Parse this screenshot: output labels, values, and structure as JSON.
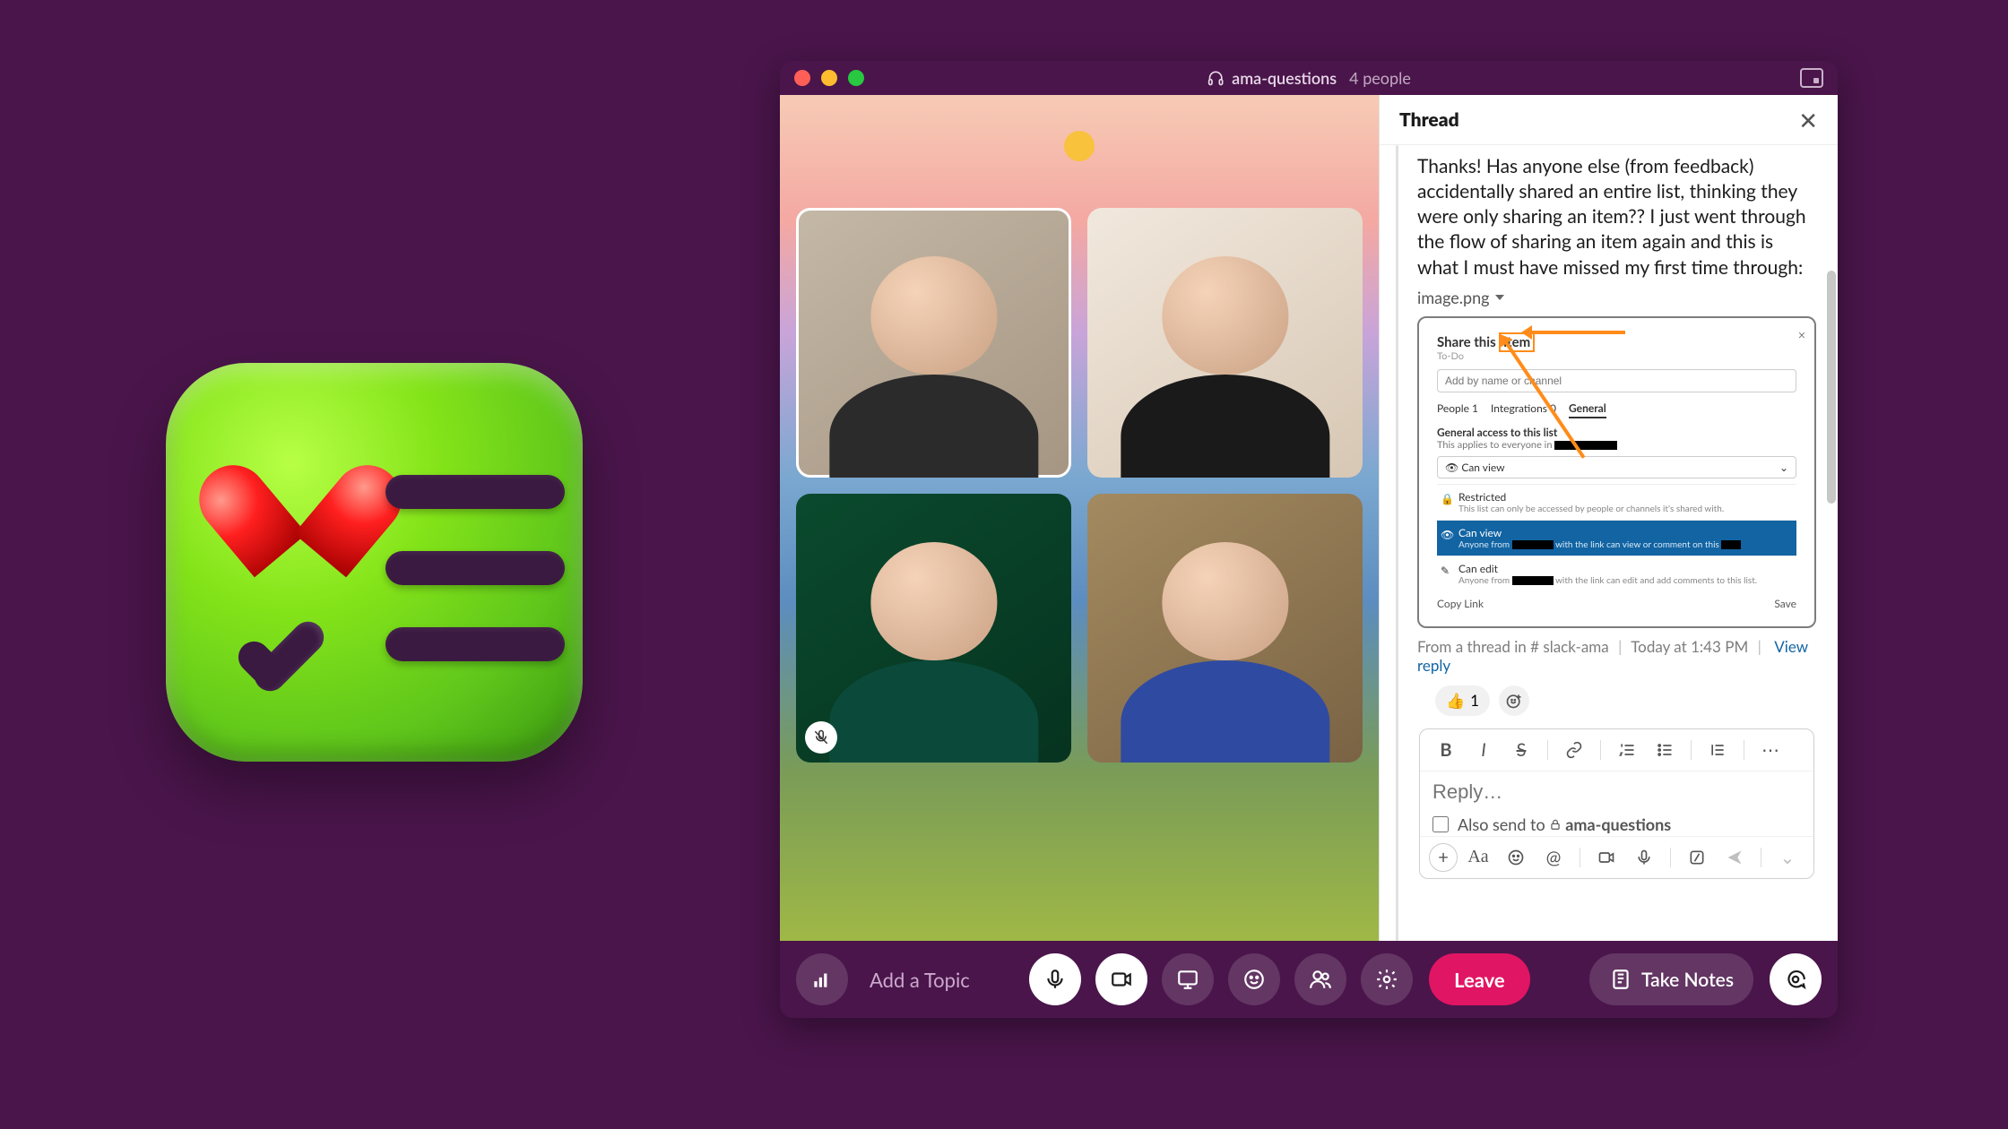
{
  "titlebar": {
    "channel_name": "ama-questions",
    "people_count": "4 people"
  },
  "thread": {
    "header": "Thread",
    "message": "Thanks! Has anyone else (from feedback) accidentally shared an entire list, thinking they were only sharing an item?? I just went through the flow of sharing an item again and this is what I must have missed my first time through:",
    "attachment_name": "image.png",
    "attachment": {
      "title_prefix": "Share this",
      "title_boxed": "item",
      "subtitle": "To-Do",
      "input_placeholder": "Add by name or channel",
      "tabs": [
        "People",
        "Integrations",
        "General"
      ],
      "tab_counts": [
        "1",
        "0",
        ""
      ],
      "active_tab": "General",
      "section_title": "General access to this list",
      "section_sub": "This applies to everyone in",
      "can_view_select": "Can view",
      "options": [
        {
          "title": "Restricted",
          "sub": "This list can only be accessed by people or channels it's shared with."
        },
        {
          "title": "Can view",
          "sub_prefix": "Anyone from",
          "sub_suffix": "with the link can view or comment on this"
        },
        {
          "title": "Can edit",
          "sub_prefix": "Anyone from",
          "sub_suffix": "with the link can edit and add comments to this list."
        }
      ],
      "copy": "Copy Link",
      "save": "Save"
    },
    "meta": {
      "prefix": "From a thread in",
      "channel": "slack-ama",
      "time": "Today at 1:43 PM",
      "view_reply": "View reply"
    },
    "reaction": {
      "emoji": "👍",
      "count": "1"
    }
  },
  "composer": {
    "placeholder": "Reply…",
    "also_send_prefix": "Also send to",
    "also_send_channel": "ama-questions"
  },
  "dock": {
    "topic_placeholder": "Add a Topic",
    "leave": "Leave",
    "take_notes": "Take Notes"
  }
}
